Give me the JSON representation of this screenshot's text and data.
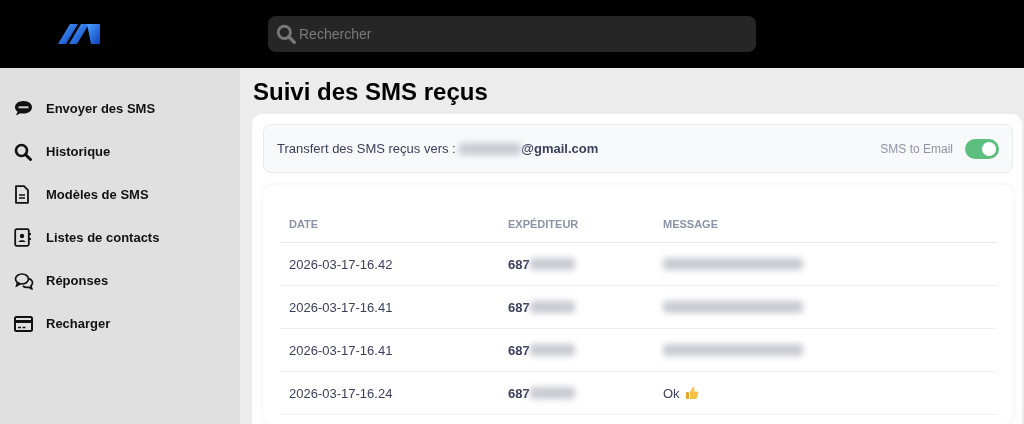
{
  "search": {
    "placeholder": "Rechercher"
  },
  "sidebar": {
    "items": [
      {
        "label": "Envoyer des SMS",
        "selected": false
      },
      {
        "label": "Historique",
        "selected": false
      },
      {
        "label": "Modèles de SMS",
        "selected": false
      },
      {
        "label": "Listes de contacts",
        "selected": false
      },
      {
        "label": "Réponses",
        "selected": false
      },
      {
        "label": "Recharger",
        "selected": false
      }
    ]
  },
  "page_title": "Suivi des SMS reçus",
  "forwarding": {
    "label": "Transfert des SMS reçus vers :",
    "email_domain": "@gmail.com",
    "toggle_label": "SMS to Email",
    "on": true
  },
  "table": {
    "columns": [
      "DATE",
      "EXPÉDITEUR",
      "MESSAGE"
    ],
    "rows": [
      {
        "date": "2026-03-17-16.42",
        "sender_prefix": "687",
        "message": {
          "kind": "redacted"
        }
      },
      {
        "date": "2026-03-17-16.41",
        "sender_prefix": "687",
        "message": {
          "kind": "redacted"
        }
      },
      {
        "date": "2026-03-17-16.41",
        "sender_prefix": "687",
        "message": {
          "kind": "redacted"
        }
      },
      {
        "date": "2026-03-17-16.24",
        "sender_prefix": "687",
        "message": {
          "kind": "reaction",
          "text": "Ok"
        }
      }
    ]
  }
}
